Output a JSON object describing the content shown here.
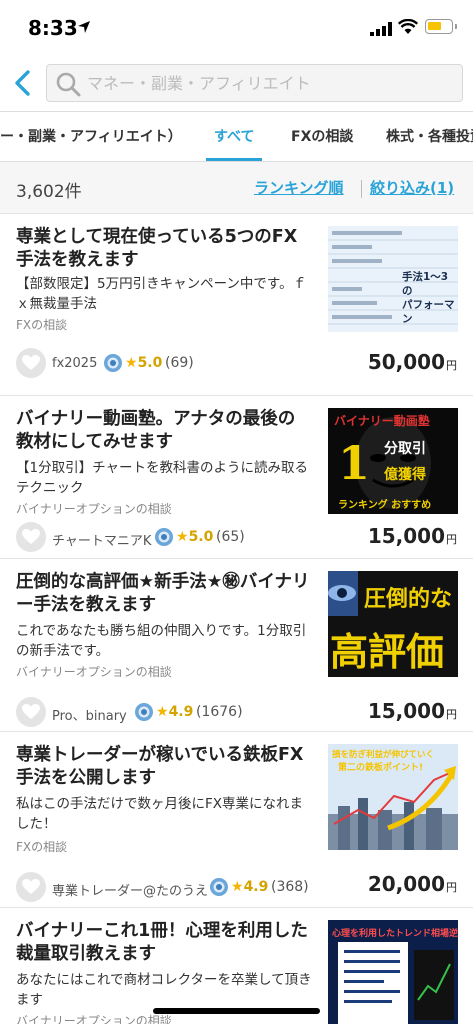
{
  "status_bar": {
    "time": "8:33"
  },
  "search": {
    "placeholder": "マネー・副業・アフィリエイト"
  },
  "tabs": [
    {
      "label": "ー・副業・アフィリエイト）"
    },
    {
      "label": "すべて",
      "active": true
    },
    {
      "label": "FXの相談"
    },
    {
      "label": "株式・各種投資"
    }
  ],
  "results": {
    "count": "3,602件",
    "ranking_label": "ランキング順",
    "filter_label": "絞り込み(1)"
  },
  "listings": [
    {
      "title": "専業として現在使っている5つのFX手法を教えます",
      "description": "【部数限定】5万円引きキャンペーン中です。ｆｘ無裁量手法",
      "category": "FXの相談",
      "seller": "fx2025",
      "rating": "5.0",
      "reviews": "(69)",
      "price": "50,000",
      "price_unit": "円",
      "thumb_lines": [
        "手法1〜3の",
        "パフォーマン"
      ]
    },
    {
      "title": "バイナリー動画塾。アナタの最後の教材にしてみせます",
      "description": "【1分取引】チャートを教科書のように読み取るテクニック",
      "category": "バイナリーオプションの相談",
      "seller": "チャートマニアK",
      "rating": "5.0",
      "reviews": "(65)",
      "price": "15,000",
      "price_unit": "円",
      "thumb_lines": [
        "バイナリー動画塾",
        "1",
        "分取引",
        "億獲得",
        "ランキング おすすめ"
      ]
    },
    {
      "title": "圧倒的な高評価★新手法★㊙バイナリー手法を教えます",
      "description": "これであなたも勝ち組の仲間入りです。1分取引の新手法です。",
      "category": "バイナリーオプションの相談",
      "seller": "Pro、binary",
      "rating": "4.9",
      "reviews": "(1676)",
      "price": "15,000",
      "price_unit": "円",
      "thumb_lines": [
        "圧倒的な",
        "高評価"
      ]
    },
    {
      "title": "専業トレーダーが稼いでいる鉄板FX手法を公開します",
      "description": "私はこの手法だけで数ヶ月後にFX専業になれました！",
      "category": "FXの相談",
      "seller": "専業トレーダー@たのうえ",
      "rating": "4.9",
      "reviews": "(368)",
      "price": "20,000",
      "price_unit": "円",
      "thumb_lines": [
        "損を防ぎ利益が伸びていく",
        "第二の鉄板ポイント!"
      ]
    },
    {
      "title": "バイナリーこれ1冊！心理を利用した裁量取引教えます",
      "description": "あなたにはこれで商材コレクターを卒業して頂きます",
      "category": "バイナリーオプションの相談",
      "thumb_lines": [
        "心理を利用したトレンド相場逆張り"
      ]
    }
  ],
  "colors": {
    "accent": "#2aa3d8",
    "rating": "#f5b400"
  }
}
